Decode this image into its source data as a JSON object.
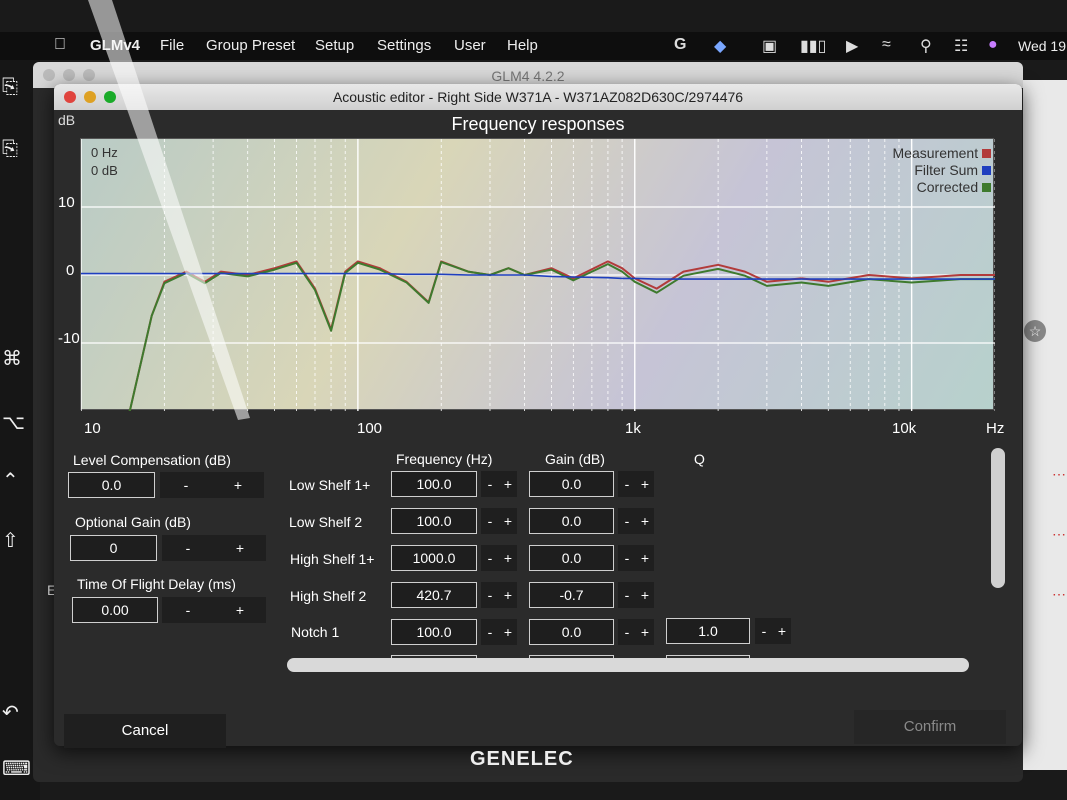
{
  "menubar": {
    "app": "GLMv4",
    "items": [
      "File",
      "Group Preset",
      "Setup",
      "Settings",
      "User",
      "Help"
    ],
    "clock": "Wed 19"
  },
  "bg_window": {
    "title": "GLM4  4.2.2",
    "side_text": "Ec"
  },
  "dialog": {
    "title": "Acoustic editor - Right Side W371A - W371AZ082D630C/2974476",
    "chart_title": "Frequency responses",
    "db_unit": "dB",
    "hz_unit": "Hz",
    "readout_hz": "0 Hz",
    "readout_db": "0 dB"
  },
  "chart_data": {
    "type": "line",
    "title": "Frequency responses",
    "xlabel": "Hz",
    "ylabel": "dB",
    "xscale": "log",
    "xlim": [
      10,
      20000
    ],
    "ylim": [
      -20,
      20
    ],
    "x_ticks": [
      "10",
      "100",
      "1k",
      "10k"
    ],
    "y_ticks": [
      "10",
      "0",
      "-10"
    ],
    "grid": true,
    "legend": "top-right",
    "x": [
      10,
      15,
      18,
      20,
      24,
      28,
      32,
      40,
      50,
      60,
      70,
      80,
      90,
      100,
      120,
      150,
      180,
      200,
      250,
      300,
      350,
      400,
      500,
      600,
      800,
      900,
      1000,
      1200,
      1500,
      2000,
      2500,
      3000,
      4000,
      5000,
      7000,
      10000,
      15000,
      20000
    ],
    "series": [
      {
        "name": "Measurement",
        "color": "#b23b3b",
        "values": [
          -30,
          -20,
          -6,
          -1,
          0.5,
          -1,
          0.5,
          0,
          1,
          2,
          -2,
          -8,
          0.5,
          2,
          1,
          -1,
          -4,
          2,
          0.5,
          0,
          1,
          0,
          1,
          -0.5,
          2,
          1,
          -0.5,
          -2,
          0.5,
          1.5,
          0.5,
          -1,
          -0.5,
          -1,
          0,
          -0.5,
          0,
          0
        ]
      },
      {
        "name": "Filter Sum",
        "color": "#1f3fbf",
        "values": [
          0.2,
          0.2,
          0.2,
          0.2,
          0.2,
          0.2,
          0.2,
          0.2,
          0.2,
          0.2,
          0.2,
          0.2,
          0.2,
          0.2,
          0.2,
          0.1,
          0.1,
          0.1,
          0,
          0,
          0,
          0,
          -0.2,
          -0.3,
          -0.4,
          -0.5,
          -0.5,
          -0.6,
          -0.6,
          -0.6,
          -0.6,
          -0.6,
          -0.6,
          -0.6,
          -0.6,
          -0.6,
          -0.6,
          -0.6
        ]
      },
      {
        "name": "Corrected",
        "color": "#3e7a2e",
        "values": [
          -30,
          -20,
          -6,
          -1.2,
          0.3,
          -1.2,
          0.3,
          -0.2,
          0.8,
          1.8,
          -2.2,
          -8.2,
          0.3,
          1.8,
          0.8,
          -1.1,
          -4.1,
          1.9,
          0.5,
          0,
          1,
          0,
          0.8,
          -0.8,
          1.6,
          0.5,
          -1,
          -2.6,
          -0.1,
          0.9,
          -0.1,
          -1.6,
          -1.1,
          -1.6,
          -0.6,
          -1.1,
          -0.6,
          -0.6
        ]
      }
    ]
  },
  "left_controls": [
    {
      "label": "Level Compensation (dB)",
      "value": "0.0"
    },
    {
      "label": "Optional Gain (dB)",
      "value": "0"
    },
    {
      "label": "Time Of Flight Delay (ms)",
      "value": "0.00"
    }
  ],
  "filter_headers": {
    "frequency": "Frequency (Hz)",
    "gain": "Gain (dB)",
    "q": "Q"
  },
  "filters": [
    {
      "name": "Low Shelf 1+",
      "frequency": "100.0",
      "gain": "0.0"
    },
    {
      "name": "Low Shelf 2",
      "frequency": "100.0",
      "gain": "0.0"
    },
    {
      "name": "High Shelf 1+",
      "frequency": "1000.0",
      "gain": "0.0"
    },
    {
      "name": "High Shelf 2",
      "frequency": "420.7",
      "gain": "-0.7"
    },
    {
      "name": "Notch 1",
      "frequency": "100.0",
      "gain": "0.0",
      "q": "1.0"
    }
  ],
  "stepper": {
    "minus": "-",
    "plus": "+"
  },
  "buttons": {
    "cancel": "Cancel",
    "confirm": "Confirm"
  },
  "brand": "GENELEC"
}
